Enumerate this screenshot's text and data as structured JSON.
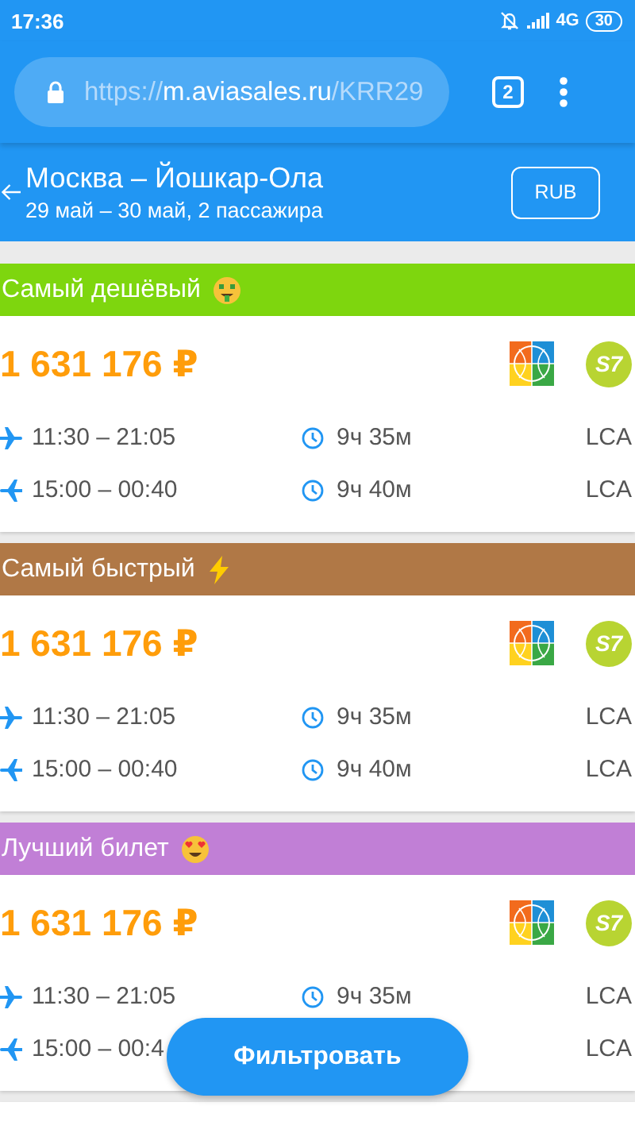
{
  "status_bar": {
    "time": "17:36",
    "network": "4G",
    "battery": "30"
  },
  "browser": {
    "url_scheme": "https://",
    "url_host": "m.aviasales.ru",
    "url_path": "/KRR29",
    "tab_count": "2"
  },
  "header": {
    "route": "Москва – Йошкар-Ола",
    "details": "29 май – 30 май, 2 пассажира",
    "currency": "RUB"
  },
  "sections": [
    {
      "title": "Самый дешёвый",
      "color": "#7ed60e",
      "price": "1 631 176 ₽",
      "airline_mark": "S7",
      "rows": [
        {
          "time": "11:30 – 21:05",
          "duration": "9ч 35м",
          "code": "LCA"
        },
        {
          "time": "15:00 – 00:40",
          "duration": "9ч 40м",
          "code": "LCA"
        }
      ]
    },
    {
      "title": "Самый быстрый",
      "color": "#b07846",
      "price": "1 631 176 ₽",
      "airline_mark": "S7",
      "rows": [
        {
          "time": "11:30 – 21:05",
          "duration": "9ч 35м",
          "code": "LCA"
        },
        {
          "time": "15:00 – 00:40",
          "duration": "9ч 40м",
          "code": "LCA"
        }
      ]
    },
    {
      "title": "Лучший билет",
      "color": "#c17fd6",
      "price": "1 631 176 ₽",
      "airline_mark": "S7",
      "rows": [
        {
          "time": "11:30 – 21:05",
          "duration": "9ч 35м",
          "code": "LCA"
        },
        {
          "time": "15:00 – 00:4",
          "code": "LCA"
        }
      ]
    }
  ],
  "filter_button": "Фильтровать"
}
